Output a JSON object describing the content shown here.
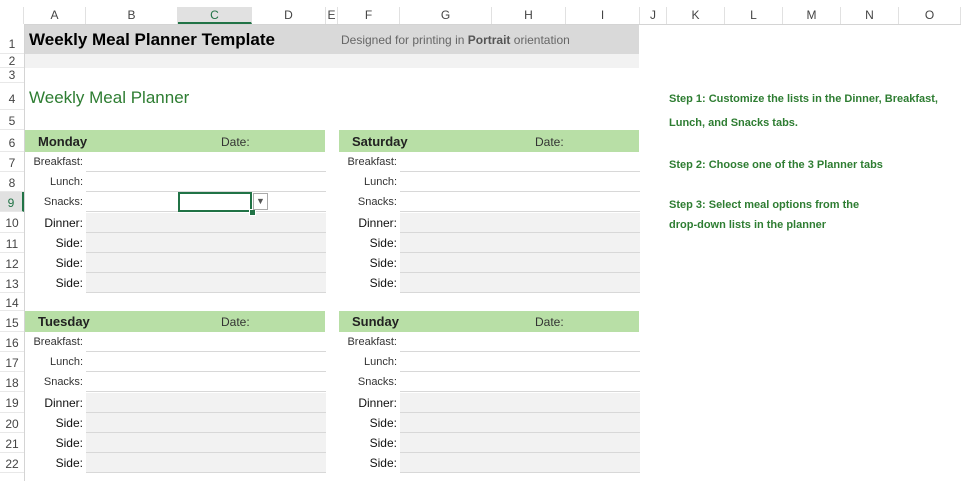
{
  "columns": [
    "A",
    "B",
    "C",
    "D",
    "E",
    "F",
    "G",
    "H",
    "I",
    "J",
    "K",
    "L",
    "M",
    "N",
    "O"
  ],
  "rows": [
    "1",
    "2",
    "3",
    "4",
    "5",
    "6",
    "7",
    "8",
    "9",
    "10",
    "11",
    "12",
    "13",
    "14",
    "15",
    "16",
    "17",
    "18",
    "19",
    "20",
    "21",
    "22"
  ],
  "selected_column": "C",
  "selected_row": "9",
  "title": {
    "main": "Weekly Meal Planner Template",
    "subtitle_pre": "Designed for printing in ",
    "subtitle_bold": "Portrait",
    "subtitle_post": " orientation"
  },
  "heading": "Weekly Meal Planner",
  "date_label": "Date:",
  "days": [
    {
      "name": "Monday",
      "meals": [
        "Breakfast:",
        "Lunch:",
        "Snacks:",
        "Dinner:",
        "Side:",
        "Side:",
        "Side:"
      ]
    },
    {
      "name": "Saturday",
      "meals": [
        "Breakfast:",
        "Lunch:",
        "Snacks:",
        "Dinner:",
        "Side:",
        "Side:",
        "Side:"
      ]
    },
    {
      "name": "Tuesday",
      "meals": [
        "Breakfast:",
        "Lunch:",
        "Snacks:",
        "Dinner:",
        "Side:",
        "Side:",
        "Side:"
      ]
    },
    {
      "name": "Sunday",
      "meals": [
        "Breakfast:",
        "Lunch:",
        "Snacks:",
        "Dinner:",
        "Side:",
        "Side:",
        "Side:"
      ]
    }
  ],
  "steps": [
    "Step 1: Customize the lists in the Dinner, Breakfast,",
    "Lunch, and Snacks tabs.",
    "Step 2: Choose one of the 3 Planner tabs",
    "Step 3: Select meal options from the",
    "drop-down lists in the planner"
  ],
  "dropdown_icon": "chevron-down-icon",
  "colors": {
    "accent": "#2e7d32",
    "day_header": "#b8dfa6",
    "title_bar": "#d9d9d9",
    "selection": "#217346"
  }
}
